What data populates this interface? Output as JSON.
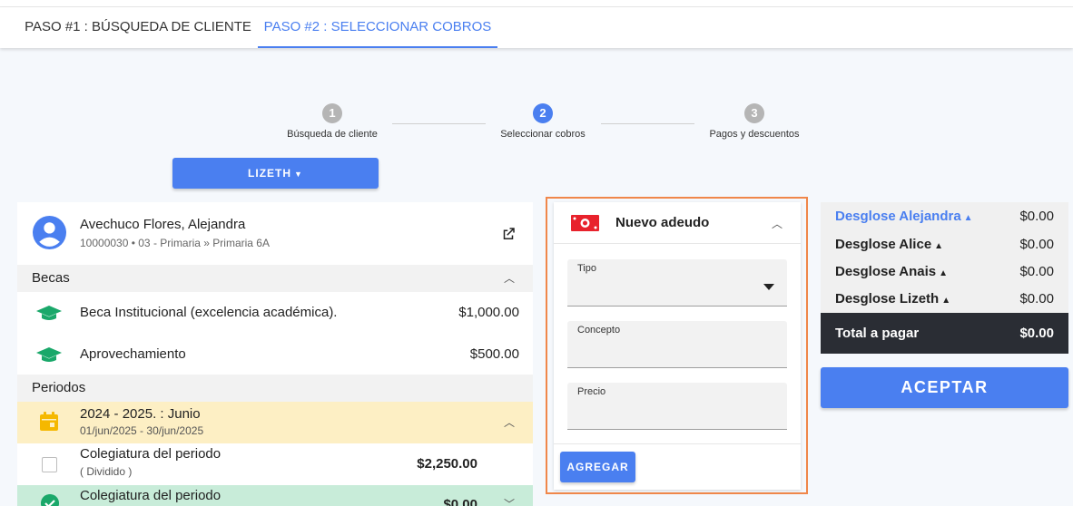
{
  "tabs": [
    {
      "label": "PASO #1 : BÚSQUEDA DE CLIENTE"
    },
    {
      "label": "PASO #2 : SELECCIONAR COBROS"
    }
  ],
  "stepper": {
    "steps": [
      {
        "number": "1",
        "label": "Búsqueda de cliente"
      },
      {
        "number": "2",
        "label": "Seleccionar cobros"
      },
      {
        "number": "3",
        "label": "Pagos y descuentos"
      }
    ],
    "active_step": 2
  },
  "student_selector": {
    "label": "LIZETH",
    "icon": "chevron-down-icon"
  },
  "profile": {
    "name": "Avechuco Flores, Alejandra",
    "info": "10000030 • 03 - Primaria » Primaria 6A"
  },
  "becas": {
    "title": "Becas",
    "items": [
      {
        "name": "Beca Institucional (excelencia académica).",
        "amount": "$1,000.00"
      },
      {
        "name": "Aprovechamiento",
        "amount": "$500.00"
      }
    ]
  },
  "periodos": {
    "title": "Periodos",
    "period": {
      "title": "2024 - 2025. : Junio",
      "dates": "01/jun/2025 - 30/jun/2025"
    },
    "cobros": [
      {
        "name": "Colegiatura del periodo",
        "sub": "( Dividido )",
        "amount": "$2,250.00"
      },
      {
        "name": "Colegiatura del periodo",
        "amount": "$0.00"
      }
    ]
  },
  "nuevo_adeudo": {
    "title": "Nuevo adeudo",
    "fields": {
      "tipo": "Tipo",
      "concepto": "Concepto",
      "precio": "Precio"
    },
    "agregar_label": "AGREGAR"
  },
  "summary": {
    "rows": [
      {
        "label": "Desglose Alejandra",
        "value": "$0.00"
      },
      {
        "label": "Desglose Alice",
        "value": "$0.00"
      },
      {
        "label": "Desglose Anais",
        "value": "$0.00"
      },
      {
        "label": "Desglose Lizeth",
        "value": "$0.00"
      }
    ],
    "total_label": "Total a pagar",
    "total_value": "$0.00"
  },
  "aceptar_label": "ACEPTAR",
  "colors": {
    "accent": "#4a7ff0",
    "highlight": "#f0874a",
    "period_bg": "#fdefc4",
    "paid_bg": "#c8ecd9",
    "total_bg": "#2a2d34"
  }
}
